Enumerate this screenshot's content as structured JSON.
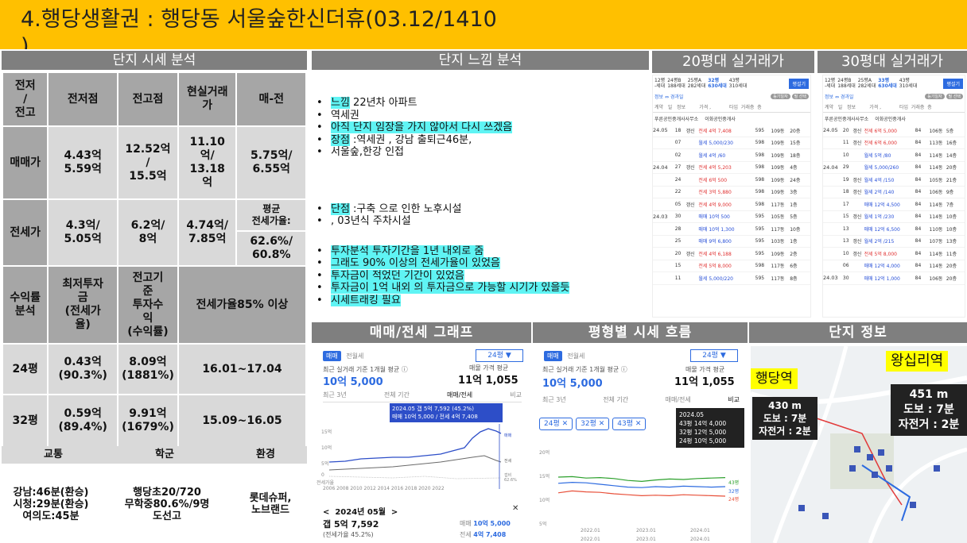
{
  "title": {
    "text": "4.행당생활권 : 행당동 서울숲한신더휴(03.12/1410",
    "overflow": ")"
  },
  "headers": {
    "analysis": "단지 시세 분석",
    "feel": "단지 느낌 분석",
    "trade20": "20평대 실거래가",
    "trade30": "30평대 실거래가",
    "graph": "매매/전세 그래프",
    "trend": "평형별 시세 흐름",
    "info": "단지  정보"
  },
  "table": {
    "h": [
      "전저\n/\n전고",
      "전저점",
      "전고점",
      "현실거래\n가",
      "매-전"
    ],
    "sale": {
      "label": "매매가",
      "low": "4.43억\n5.59억",
      "high": "12.52억\n/\n15.5억",
      "real": "11.10\n억/\n13.18\n억",
      "diff": "5.75억/\n6.55억"
    },
    "jeonse": {
      "label": "전세가",
      "low": "4.3억/\n5.05억",
      "high": "6.2억/\n8억",
      "real": "4.74억/\n7.85억",
      "ratio_label": "평균\n전세가율:",
      "ratio": "62.6%/\n60.8%"
    },
    "yield": {
      "label": "수익률\n분석",
      "min": "최저투자\n금\n(전세가\n율)",
      "hist": "전고기\n준\n투자수\n익\n(수익률)",
      "note": "전세가율85% 이상"
    },
    "p24": {
      "label": "24평",
      "min": "0.43억\n(90.3%)",
      "hist": "8.09억\n(1881%)",
      "period": "16.01~17.04"
    },
    "p32": {
      "label": "32평",
      "min": "0.59억\n(89.4%)",
      "hist": "9.91억\n(1679%)",
      "period": "15.09~16.05"
    }
  },
  "foot": {
    "h1": "교통",
    "h2": "학군",
    "h3": "환경",
    "t1": "강남:46분(환승)\n시청:29분(환승)\n여의도:45분",
    "t2": "행당초20/720\n무학중80.6%/9명\n도선고",
    "t3": "롯데슈퍼,\n노브랜드"
  },
  "bullets1": [
    {
      "hl": "느낌",
      "rest": " 22년차 아파트"
    },
    {
      "hl": "",
      "rest": "역세권"
    },
    {
      "hl": "아직 단지 임장을 가지 않아서 다시 쓰겠음",
      "rest": ""
    },
    {
      "hl": "장점",
      "rest": " :역세권 , 강남 출퇴근46분,"
    },
    {
      "hl": "",
      "rest": "서울숲,한강 인접"
    }
  ],
  "bullets2": [
    {
      "hl": "단점",
      "rest": " :구축 으로 인한 노후시설"
    },
    {
      "hl": "",
      "rest": ", 03년식  주차시설"
    }
  ],
  "bullets3": [
    {
      "hl": "투자분석 투자기간을 1년 내외로 줌",
      "rest": ""
    },
    {
      "hl": "그래도 90% 이상의 전세가율이 있었음",
      "rest": ""
    },
    {
      "hl": "투자금이 적었던 기간이 있었음",
      "rest": ""
    },
    {
      "hl": "투자금이 1억 내외 의 투자금으로 가능할 시기가 있을듯",
      "rest": ""
    },
    {
      "hl": "시세트래킹 필요",
      "rest": ""
    }
  ],
  "t20": {
    "tabs": [
      "12평\n-세대",
      "24평B\n188세대",
      "25평A\n282세대",
      "32평\n630세대",
      "43평\n310세대"
    ],
    "btn": "평설기",
    "filter": "정보 ⇔ 경과일",
    "chips": [
      "등기일자",
      "필 선택"
    ],
    "cols": "계약   일   정보         가격 ,            타입  거래층  층",
    "agents": [
      "푸른공인중개사사무소",
      "이화공인중개사"
    ],
    "rows": [
      [
        "24.05",
        "18",
        "갱신",
        "전세 4억 7,408",
        "595",
        "109동",
        "20층"
      ],
      [
        "",
        "07",
        "",
        "월세 5,000/230",
        "598",
        "109동",
        "15층"
      ],
      [
        "",
        "02",
        "",
        "월세 4억 /60",
        "598",
        "109동",
        "18층"
      ],
      [
        "24.04",
        "27",
        "갱신",
        "전세 4억 5,203",
        "598",
        "109동",
        "4층"
      ],
      [
        "",
        "24",
        "",
        "전세 6억 500",
        "598",
        "109동",
        "24층"
      ],
      [
        "",
        "22",
        "",
        "전세 3억 5,880",
        "598",
        "109동",
        "3층"
      ],
      [
        "",
        "05",
        "갱신",
        "전세 4억 9,000",
        "598",
        "117동",
        "1층"
      ],
      [
        "24.03",
        "30",
        "",
        "매매 10억 500",
        "595",
        "105동",
        "5층"
      ],
      [
        "",
        "28",
        "",
        "매매 10억 1,300",
        "595",
        "117동",
        "10층"
      ],
      [
        "",
        "25",
        "",
        "매매 9억 6,800",
        "595",
        "103동",
        "1층"
      ],
      [
        "",
        "20",
        "갱신",
        "전세 4억 6,188",
        "595",
        "109동",
        "2층"
      ],
      [
        "",
        "15",
        "",
        "전세 5억 8,000",
        "598",
        "117동",
        "6층"
      ],
      [
        "",
        "11",
        "",
        "월세 5,000/220",
        "595",
        "117동",
        "8층"
      ]
    ]
  },
  "t30": {
    "tabs": [
      "12평\n-세대",
      "24평B\n188세대",
      "25평A\n282세대",
      "33평\n630세대",
      "43평\n310세대"
    ],
    "btn": "평설기",
    "filter": "정보 ⇔ 경과일",
    "chips": [
      "등기일자",
      "필 선택"
    ],
    "cols": "계약   일   정보         가격 ,            타입  거래층  층",
    "agents": [
      "푸른공인중개사사무소",
      "이화공인중개사"
    ],
    "rows": [
      [
        "24.05",
        "20",
        "갱신",
        "전세 6억 5,000",
        "84",
        "106동",
        "5층"
      ],
      [
        "",
        "11",
        "갱신",
        "전세 6억 6,000",
        "84",
        "113동",
        "16층"
      ],
      [
        "",
        "10",
        "",
        "월세 5억 /80",
        "84",
        "114동",
        "14층"
      ],
      [
        "24.04",
        "29",
        "",
        "월세 5,000/260",
        "84",
        "114동",
        "20층"
      ],
      [
        "",
        "19",
        "갱신",
        "월세 4억 /150",
        "84",
        "105동",
        "21층"
      ],
      [
        "",
        "18",
        "갱신",
        "월세 2억 /140",
        "84",
        "106동",
        "9층"
      ],
      [
        "",
        "17",
        "",
        "매매 12억 4,500",
        "84",
        "114동",
        "7층"
      ],
      [
        "",
        "15",
        "갱신",
        "월세 1억 /230",
        "84",
        "114동",
        "10층"
      ],
      [
        "",
        "13",
        "",
        "매매 12억 6,500",
        "84",
        "110동",
        "10층"
      ],
      [
        "",
        "13",
        "갱신",
        "월세 2억 /215",
        "84",
        "107동",
        "13층"
      ],
      [
        "",
        "10",
        "갱신",
        "전세 5억 8,000",
        "84",
        "114동",
        "11층"
      ],
      [
        "",
        "06",
        "",
        "매매 12억 4,000",
        "84",
        "114동",
        "20층"
      ],
      [
        "24.03",
        "30",
        "",
        "매매 12억 1,000",
        "84",
        "106동",
        "20층"
      ]
    ]
  },
  "graph": {
    "tabs": [
      "매매",
      "전월세"
    ],
    "sel": "24평 ▼",
    "avg_label": "최근 실거래 기준 1개월 평균 ⓘ",
    "avg": "10억 5,000",
    "ask_label": "매물 가격 평균",
    "ask": "11억 1,055",
    "subtabs": [
      "최근 3년",
      "전체 기간",
      "매매/전세",
      "비교"
    ],
    "tip1": "2024.05  갭 5억 7,592 (45.2%)",
    "tip2": "매매 10억 5,000 / 전세 4억 7,408",
    "y": [
      "15억",
      "10억",
      "5억",
      "0",
      "전세가율"
    ],
    "x": "2006 2008 2010 2012 2014 2016 2018 2020 2022",
    "legend": [
      "매매",
      "전세",
      "갭비",
      "62.6%"
    ],
    "month": "<  2024년 05월  >",
    "close": "✕",
    "gap": "갭 5억 7,592",
    "gapratio": "(전세가율 45.2%)",
    "sale_l": "매매",
    "sale": "10억 5,000",
    "jeon_l": "전세",
    "jeon": "4억 7,408"
  },
  "trend": {
    "tabs": [
      "매매",
      "전월세"
    ],
    "sel": "24평 ▼",
    "avg_label": "최근 실거래 기준 1개월 평균 ⓘ",
    "avg": "10억 5,000",
    "ask_label": "매물 가격 평균",
    "ask": "11억 1,055",
    "subtabs": [
      "최근 3년",
      "전체 기간",
      "매매/전세",
      "비교"
    ],
    "chips": [
      "24평 ✕",
      "32평 ✕",
      "43평 ✕"
    ],
    "tip": [
      "2024.05",
      "43평 14억 4,000",
      "32평 12억 5,000",
      "24평 10억 5,000"
    ],
    "y": [
      "20억",
      "15억",
      "10억",
      "5억"
    ],
    "x": [
      "2022.01",
      "2023.01",
      "2024.01"
    ],
    "x2": [
      "2022.01",
      "2023.01",
      "2024.01"
    ],
    "lines": [
      "43평",
      "32평",
      "24평"
    ],
    "series": [
      {
        "name": "43평",
        "color": "#2ca02c",
        "values": [
          14.5,
          14.6,
          14.3,
          14.4,
          14.2,
          13.8,
          13.6,
          13.9,
          14.1,
          14.0,
          14.2,
          14.3,
          14.4
        ]
      },
      {
        "name": "32평",
        "color": "#2d6be0",
        "values": [
          13.2,
          13.4,
          13.3,
          13.0,
          12.7,
          12.4,
          12.3,
          12.5,
          12.4,
          12.6,
          12.5,
          12.4,
          12.5
        ]
      },
      {
        "name": "24평",
        "color": "#e8503a",
        "values": [
          11.2,
          11.6,
          11.4,
          11.3,
          11.0,
          10.8,
          10.6,
          10.7,
          10.6,
          10.8,
          10.7,
          10.6,
          10.5
        ]
      }
    ]
  },
  "info": {
    "st1": "행당역",
    "st2": "왕십리역",
    "d1": "430 m\n도보 : 7분\n자전거 : 2분",
    "d2": "451 m\n도보 : 7분\n자전거 : 2분"
  },
  "colors": {
    "title_bg": "#ffc000",
    "section": "#7f7f7f",
    "table_dark": "#a6a6a6",
    "table_light": "#d9d9d9",
    "highlight": "#5ff4f4",
    "sale": "#2d6be0",
    "jeonse": "#e03030"
  }
}
